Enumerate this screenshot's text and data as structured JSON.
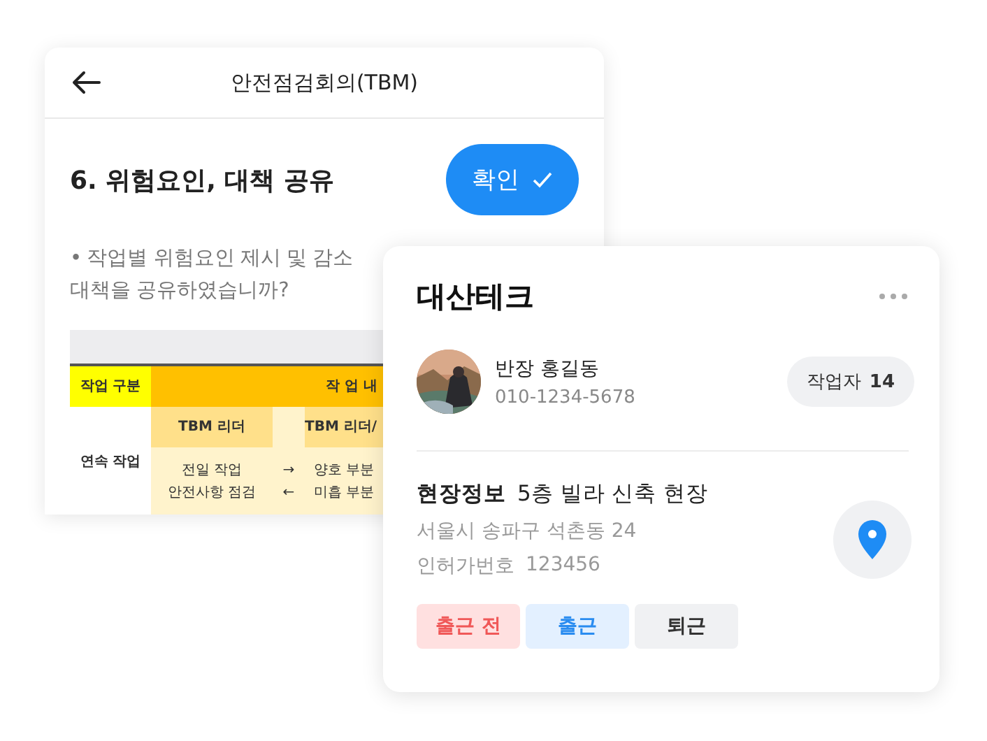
{
  "back_card": {
    "title": "안전점검회의(TBM)",
    "section_title": "6. 위험요인, 대책 공유",
    "confirm_button": "확인",
    "question": [
      "• 작업별 위험요인 제시 및 감소",
      "대책을 공유하였습니까?"
    ],
    "table": {
      "header": [
        "작업 구분",
        "작 업 내"
      ],
      "row_label": "연속 작업",
      "sub_headers": [
        "TBM 리더",
        "TBM 리더/"
      ],
      "arrows": [
        "→",
        "←"
      ],
      "cells": [
        "전일 작업\n안전사항 점검",
        "양호 부분\n미흡 부분"
      ]
    }
  },
  "front_card": {
    "company": "대산테크",
    "leader": {
      "name": "반장 홍길동",
      "phone": "010-1234-5678"
    },
    "worker_badge": {
      "label": "작업자",
      "count": "14"
    },
    "site": {
      "label": "현장정보",
      "name": "5층 빌라 신축 현장",
      "address": "서울시 송파구 석촌동 24",
      "permit_label": "인허가번호",
      "permit_number": "123456"
    },
    "status_buttons": [
      {
        "label": "출근 전",
        "kind": "before"
      },
      {
        "label": "출근",
        "kind": "in"
      },
      {
        "label": "퇴근",
        "kind": "out"
      }
    ]
  }
}
